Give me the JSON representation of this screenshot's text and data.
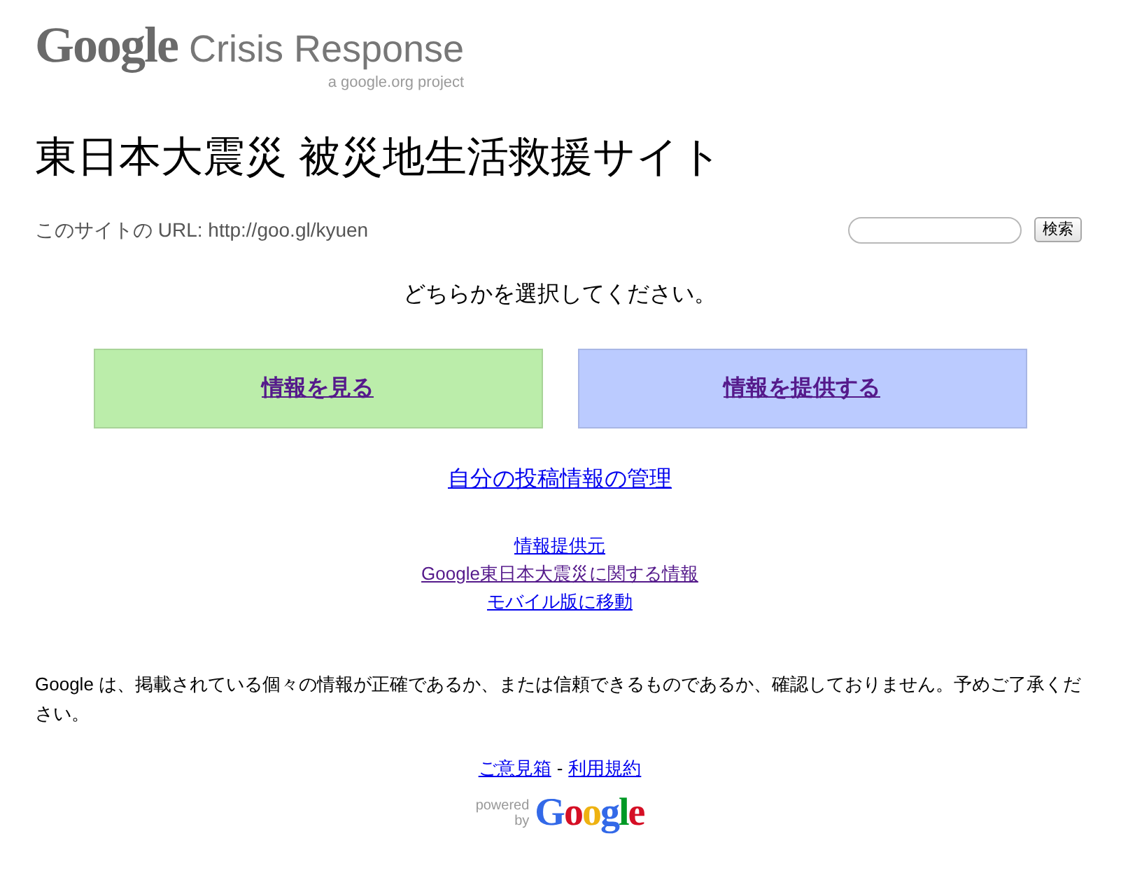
{
  "header": {
    "logo_brand": "Google",
    "logo_product": "Crisis Response",
    "tagline": "a google.org project"
  },
  "title": "東日本大震災 被災地生活救援サイト",
  "site_url": "このサイトの URL: http://goo.gl/kyuen",
  "search": {
    "button": "検索"
  },
  "prompt": "どちらかを選択してください。",
  "choices": [
    {
      "label": "情報を見る",
      "color": "#bbedaa",
      "visited": true
    },
    {
      "label": "情報を提供する",
      "color": "#bbcbff",
      "visited": true
    }
  ],
  "manage_link": {
    "label": "自分の投稿情報の管理",
    "visited": false
  },
  "links": [
    {
      "label": "情報提供元",
      "visited": false
    },
    {
      "label": "Google東日本大震災に関する情報",
      "visited": true
    },
    {
      "label": "モバイル版に移動",
      "visited": false
    }
  ],
  "disclaimer": "Google は、掲載されている個々の情報が正確であるか、または信頼できるものであるか、確認しておりません。予めご了承ください。",
  "footer": {
    "links": [
      {
        "label": "ご意見箱",
        "visited": false
      },
      {
        "label": "利用規約",
        "visited": false
      }
    ],
    "separator": "-"
  },
  "powered_by": {
    "line_1": "powered",
    "line_2": "by",
    "brand": "Google"
  }
}
